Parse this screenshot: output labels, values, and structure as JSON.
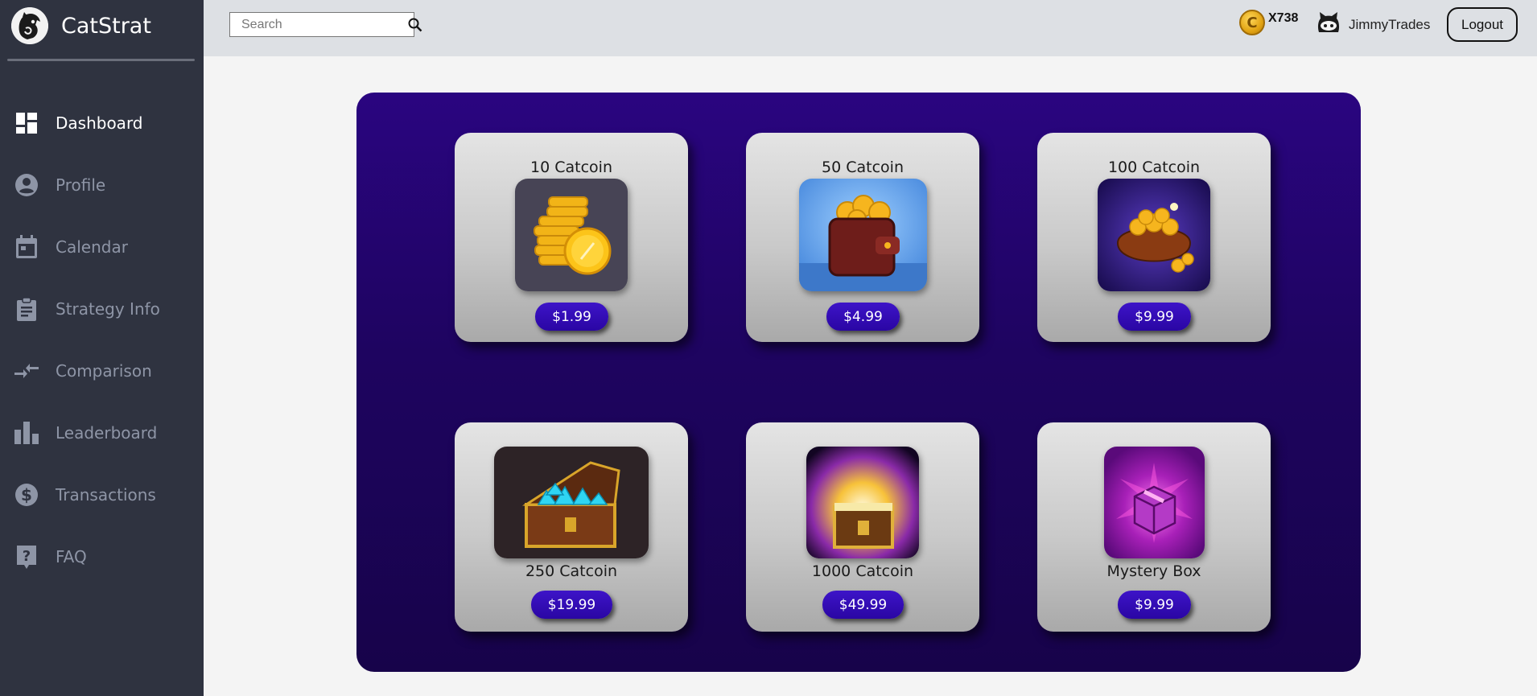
{
  "app": {
    "name": "CatStrat"
  },
  "sidebar": {
    "items": [
      {
        "label": "Dashboard",
        "icon": "dashboard-icon",
        "active": true
      },
      {
        "label": "Profile",
        "icon": "profile-icon"
      },
      {
        "label": "Calendar",
        "icon": "calendar-icon"
      },
      {
        "label": "Strategy Info",
        "icon": "clipboard-icon"
      },
      {
        "label": "Comparison",
        "icon": "compare-arrows-icon"
      },
      {
        "label": "Leaderboard",
        "icon": "bar-chart-icon"
      },
      {
        "label": "Transactions",
        "icon": "dollar-circle-icon"
      },
      {
        "label": "FAQ",
        "icon": "help-icon"
      }
    ]
  },
  "topbar": {
    "search_placeholder": "Search",
    "coin_count": "X738",
    "username": "JimmyTrades",
    "logout_label": "Logout"
  },
  "store": {
    "items": [
      {
        "title": "10 Catcoin",
        "price": "$1.99",
        "image": "coin-stack-image"
      },
      {
        "title": "50 Catcoin",
        "price": "$4.99",
        "image": "coin-wallet-image"
      },
      {
        "title": "100 Catcoin",
        "price": "$9.99",
        "image": "coin-sack-image"
      },
      {
        "title": "250 Catcoin",
        "price": "$19.99",
        "image": "gem-chest-image"
      },
      {
        "title": "1000 Catcoin",
        "price": "$49.99",
        "image": "glowing-chest-image"
      },
      {
        "title": "Mystery Box",
        "price": "$9.99",
        "image": "mystery-box-image"
      }
    ]
  },
  "colors": {
    "sidebar_bg": "#2f3340",
    "topbar_bg": "#dde0e4",
    "store_bg": "#22056a",
    "price_button": "#2f0bb0"
  }
}
